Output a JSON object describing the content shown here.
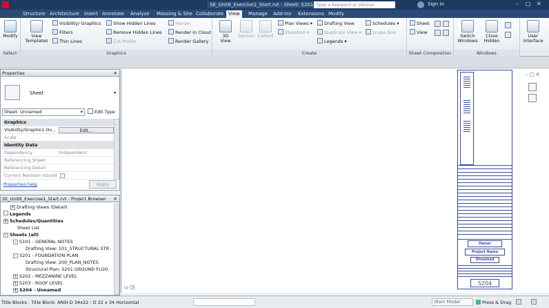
{
  "title_bar": {
    "doc_title": "SE_Unit6_Exercise1_Start.rvt - Sheet: S201...",
    "search_placeholder": "Type a keyword or phrase",
    "signin": "Sign In"
  },
  "tabs": [
    "Structure",
    "Architecture",
    "Insert",
    "Annotate",
    "Analyze",
    "Massing & Site",
    "Collaborate",
    "View",
    "Manage",
    "Add-Ins",
    "Extensions",
    "Modify"
  ],
  "active_tab": "View",
  "ribbon": {
    "select": {
      "button": "Modify",
      "label": "Select"
    },
    "graphics": {
      "view_templates": "View Templates",
      "visibility": "Visibility/ Graphics",
      "filters": "Filters",
      "thin_lines": "Thin Lines",
      "show_hidden": "Show Hidden Lines",
      "remove_hidden": "Remove Hidden Lines",
      "cut_profile": "Cut Profile",
      "render": "Render",
      "render_cloud": "Render in Cloud",
      "render_gallery": "Render Gallery",
      "label": "Graphics"
    },
    "create": {
      "view_3d": "3D View",
      "section": "Section",
      "callout": "Callout",
      "plan_views": "Plan Views",
      "elevation": "Elevation",
      "legends": "Legends",
      "drafting_view": "Drafting View",
      "duplicate_view": "Duplicate View",
      "schedules": "Schedules",
      "scope_box": "Scope Box",
      "label": "Create"
    },
    "sheet_comp": {
      "sheet": "Sheet",
      "view": "View",
      "label": "Sheet Composition"
    },
    "windows": {
      "switch": "Switch Windows",
      "close_hidden": "Close Hidden",
      "user_interface": "User Interface",
      "label": "Windows"
    }
  },
  "properties": {
    "header": "Properties",
    "type_name": "Sheet",
    "selector": "Sheet: Unnamed",
    "edit_type": "Edit Type",
    "rows": [
      {
        "k": "Graphics",
        "v": "",
        "cat": true
      },
      {
        "k": "Visibility/Graphics Ov...",
        "v": "Edit...",
        "cat": false
      },
      {
        "k": "Scale",
        "v": "",
        "cat": false
      },
      {
        "k": "Identity Data",
        "v": "",
        "cat": true
      },
      {
        "k": "Dependency",
        "v": "Independent",
        "cat": false
      },
      {
        "k": "Referencing Sheet",
        "v": "",
        "cat": false
      },
      {
        "k": "Referencing Detail",
        "v": "",
        "cat": false
      },
      {
        "k": "Current Revision Issued",
        "v": "",
        "cat": false
      }
    ],
    "help": "Properties help",
    "apply": "Apply"
  },
  "browser": {
    "header": "SE_Unit6_Exercise1_Start.rvt - Project Browser",
    "items": [
      {
        "t": "Drafting Views (Detail)",
        "lvl": 1,
        "pm": "+"
      },
      {
        "t": "Legends",
        "lvl": 0,
        "pm": ""
      },
      {
        "t": "Schedules/Quantities",
        "lvl": 0,
        "pm": "+"
      },
      {
        "t": "Sheet List",
        "lvl": 1,
        "pm": ""
      },
      {
        "t": "Sheets (all)",
        "lvl": 0,
        "pm": "-"
      },
      {
        "t": "S101 - GENERAL NOTES",
        "lvl": 1,
        "pm": "-"
      },
      {
        "t": "Drafting View: 101_STRUCTURAL STR",
        "lvl": 2,
        "pm": ""
      },
      {
        "t": "S201 - FOUNDATION PLAN",
        "lvl": 1,
        "pm": "-"
      },
      {
        "t": "Drafting View: 200_PLAN_NOTES",
        "lvl": 2,
        "pm": ""
      },
      {
        "t": "Structural Plan: S201 GROUND FLOO",
        "lvl": 2,
        "pm": ""
      },
      {
        "t": "S202 - MEZZANINE LEVEL",
        "lvl": 1,
        "pm": "+"
      },
      {
        "t": "S203 - ROOF LEVEL",
        "lvl": 1,
        "pm": "+"
      },
      {
        "t": "S204 - Unnamed",
        "lvl": 1,
        "pm": "+"
      }
    ]
  },
  "sheet": {
    "owner": "Owner",
    "project_name": "Project Name",
    "unnamed": "Unnamed",
    "number": "S204"
  },
  "status": {
    "text": "Title Blocks : Title Block: ANSI-D 34x22 : D 22 x 34 Horizontal",
    "model": "Main Model",
    "press_drag": "Press & Drag"
  }
}
